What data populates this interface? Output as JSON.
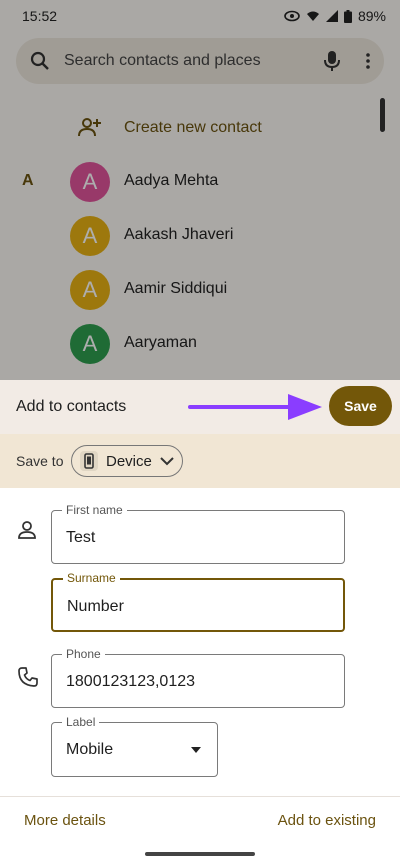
{
  "status_bar": {
    "time": "15:52",
    "battery": "89%"
  },
  "search": {
    "placeholder": "Search contacts and places"
  },
  "create_contact": {
    "label": "Create new contact"
  },
  "section_letter": "A",
  "contacts": [
    {
      "initial": "A",
      "name": "Aadya Mehta",
      "color": "#e0549b"
    },
    {
      "initial": "A",
      "name": "Aakash Jhaveri",
      "color": "#e8b214"
    },
    {
      "initial": "A",
      "name": "Aamir Siddiqui",
      "color": "#e8b214"
    },
    {
      "initial": "A",
      "name": "Aaryaman",
      "color": "#2e9e4f"
    }
  ],
  "sheet": {
    "title": "Add to contacts",
    "save_label": "Save",
    "save_to_label": "Save to",
    "device_label": "Device",
    "fields": {
      "first_name": {
        "label": "First name",
        "value": "Test"
      },
      "surname": {
        "label": "Surname",
        "value": "Number"
      },
      "phone": {
        "label": "Phone",
        "value": "1800123123,0123"
      },
      "phone_label": {
        "label": "Label",
        "value": "Mobile"
      }
    },
    "more_details": "More details",
    "add_to_existing": "Add to existing"
  },
  "colors": {
    "accent": "#735709",
    "annotation_arrow": "#8a3dff"
  }
}
